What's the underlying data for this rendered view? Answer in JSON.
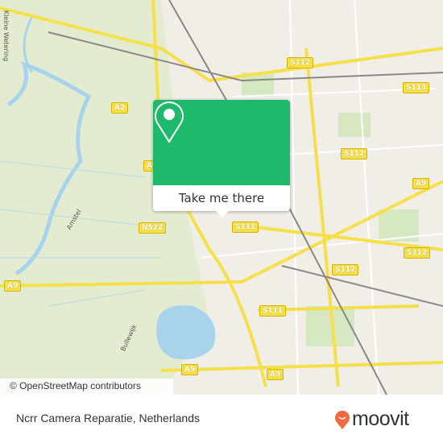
{
  "map": {
    "attribution": "© OpenStreetMap contributors",
    "road_shields": [
      {
        "label": "S112"
      },
      {
        "label": "S113"
      },
      {
        "label": "S112"
      },
      {
        "label": "A9"
      },
      {
        "label": "S111"
      },
      {
        "label": "S112"
      },
      {
        "label": "S112"
      },
      {
        "label": "S111"
      },
      {
        "label": "A9"
      },
      {
        "label": "A9"
      },
      {
        "label": "A9"
      },
      {
        "label": "A2"
      },
      {
        "label": "A9"
      },
      {
        "label": "N522"
      }
    ],
    "street_labels": [
      "Amstel",
      "Bullewijk",
      "Kleine Wetering"
    ],
    "colors": {
      "land": "#e8efd9",
      "urban": "#f1eee8",
      "water": "#a9d3ec",
      "motorway": "#f6e04a",
      "accent": "#1dba6c"
    }
  },
  "popup": {
    "icon": "map-pin-icon",
    "button_label": "Take me there"
  },
  "footer": {
    "place_name": "Ncrr Camera Reparatie, Netherlands",
    "brand": "moovit",
    "brand_color": "#f26a3d"
  }
}
